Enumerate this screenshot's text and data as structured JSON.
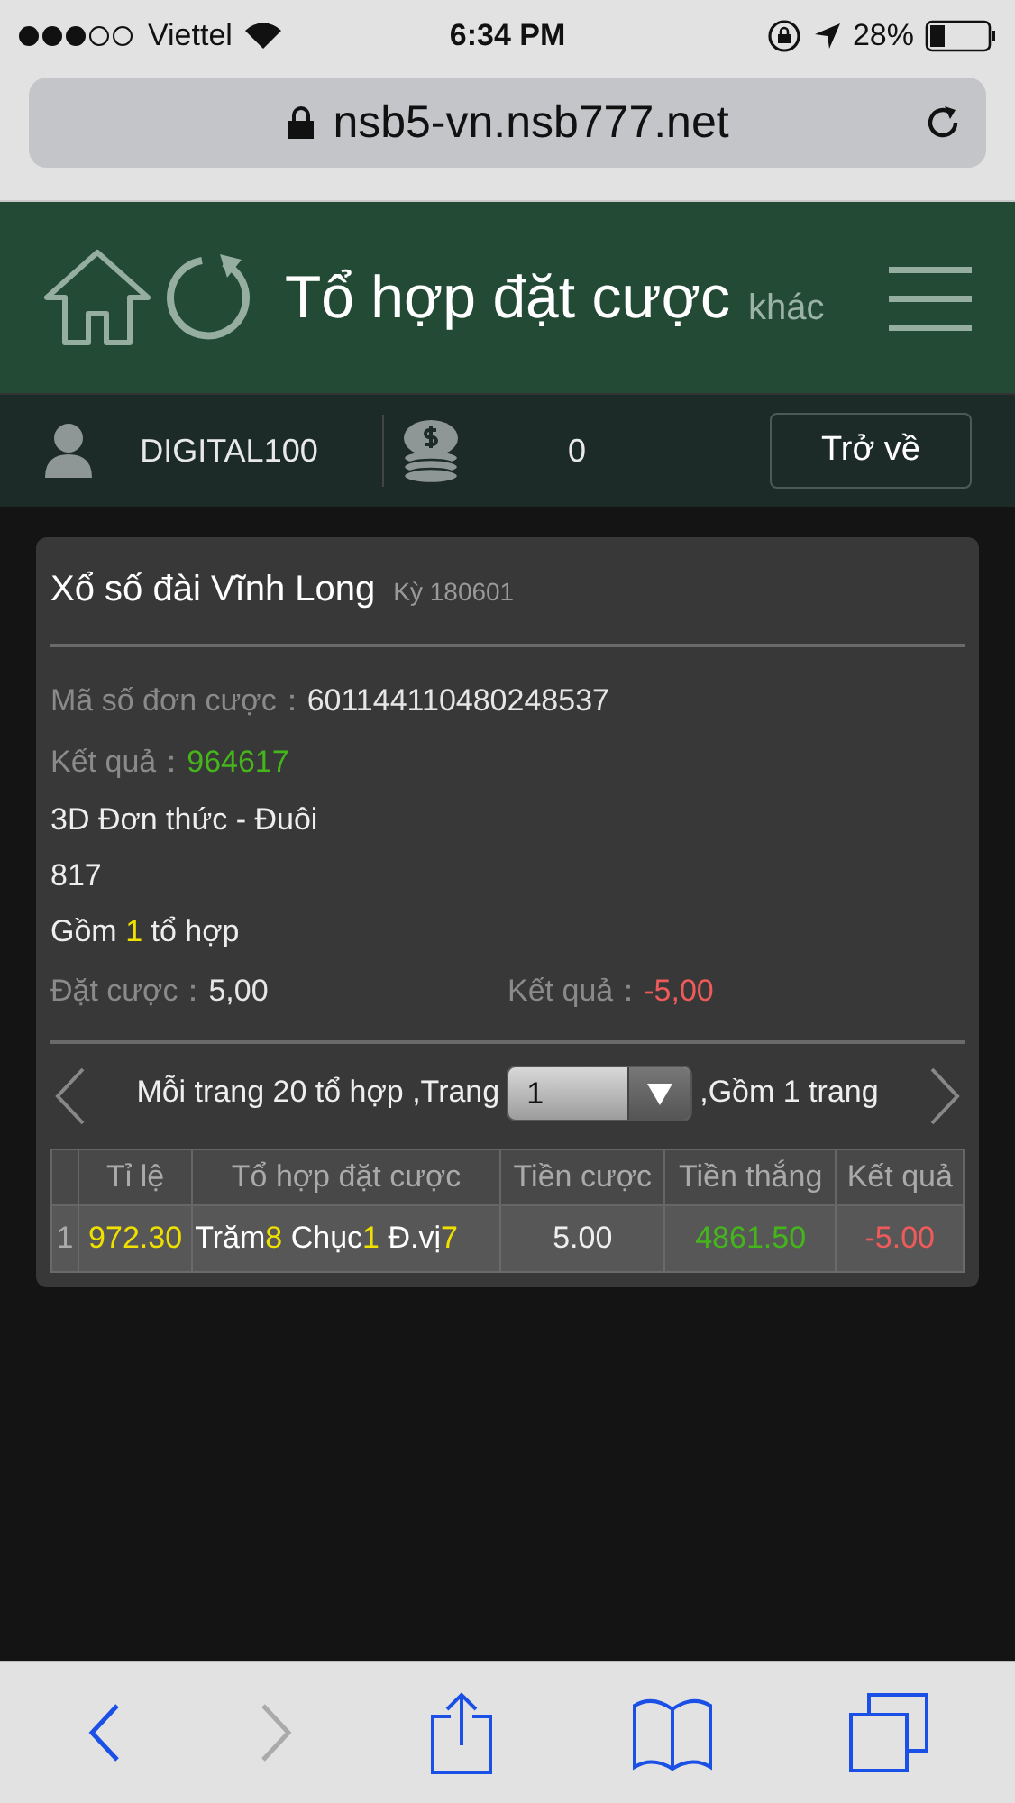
{
  "status_bar": {
    "carrier": "Viettel",
    "time": "6:34 PM",
    "battery": "28%"
  },
  "browser": {
    "url": "nsb5-vn.nsb777.net"
  },
  "header": {
    "title": "Tổ hợp đặt cược",
    "subtitle": "khác"
  },
  "user_bar": {
    "username": "DIGITAL100",
    "balance": "0",
    "back_button": "Trở về"
  },
  "card": {
    "title": "Xổ số đài Vĩnh Long",
    "period": "Kỳ 180601",
    "fields": [
      {
        "label": "Mã số đơn cược：",
        "value": "601144110480248537",
        "color": "#e6e6e6"
      },
      {
        "label": "Kết quả：",
        "value": "964617",
        "color": "#45b51c"
      }
    ],
    "bet_type": "3D Đơn thức - Đuôi",
    "numbers": "817",
    "combo_count": {
      "prefix": "Gồm",
      "count": "1",
      "suffix": "tổ hợp"
    },
    "totals": [
      {
        "label": "Đặt cược：",
        "value": "5,00",
        "color": "#e6e6e6"
      },
      {
        "label": "Kết quả：",
        "value": "-5,00",
        "color": "#ef5a5a"
      }
    ],
    "pagination": {
      "before": "Mỗi trang 20 tổ hợp ,Trang",
      "page": "1",
      "after": ",Gồm 1 trang",
      "prev_disabled": true,
      "next_disabled": true
    },
    "table": {
      "columns": [
        "Tỉ lệ",
        "Tổ hợp đặt cược",
        "Tiền cược",
        "Tiền thắng",
        "Kết quả"
      ],
      "rows": [
        {
          "index": "1",
          "odds": "972.30",
          "combination": [
            {
              "label": "Trăm",
              "digit": "8"
            },
            {
              "label": " Chục",
              "digit": "1"
            },
            {
              "label": " Đ.vị",
              "digit": "7"
            }
          ],
          "stake": "5.00",
          "winnings": "4861.50",
          "result": "-5.00"
        }
      ]
    }
  },
  "toolbar": {
    "back_disabled": false,
    "forward_disabled": true
  }
}
